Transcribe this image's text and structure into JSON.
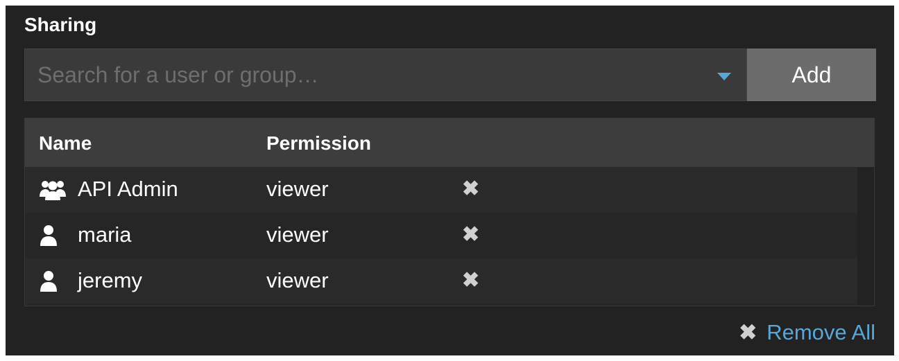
{
  "section": {
    "title": "Sharing"
  },
  "search": {
    "placeholder": "Search for a user or group…",
    "value": ""
  },
  "add_button": {
    "label": "Add"
  },
  "table": {
    "headers": {
      "name": "Name",
      "permission": "Permission"
    },
    "rows": [
      {
        "icon": "group-icon",
        "name": "API Admin",
        "permission": "viewer"
      },
      {
        "icon": "user-icon",
        "name": "maria",
        "permission": "viewer"
      },
      {
        "icon": "user-icon",
        "name": "jeremy",
        "permission": "viewer"
      }
    ],
    "remove_glyph": "✖"
  },
  "remove_all": {
    "glyph": "✖",
    "label": "Remove All"
  },
  "colors": {
    "panel": "#222222",
    "accent": "#5aa6d6",
    "button": "#6c6c6c"
  }
}
